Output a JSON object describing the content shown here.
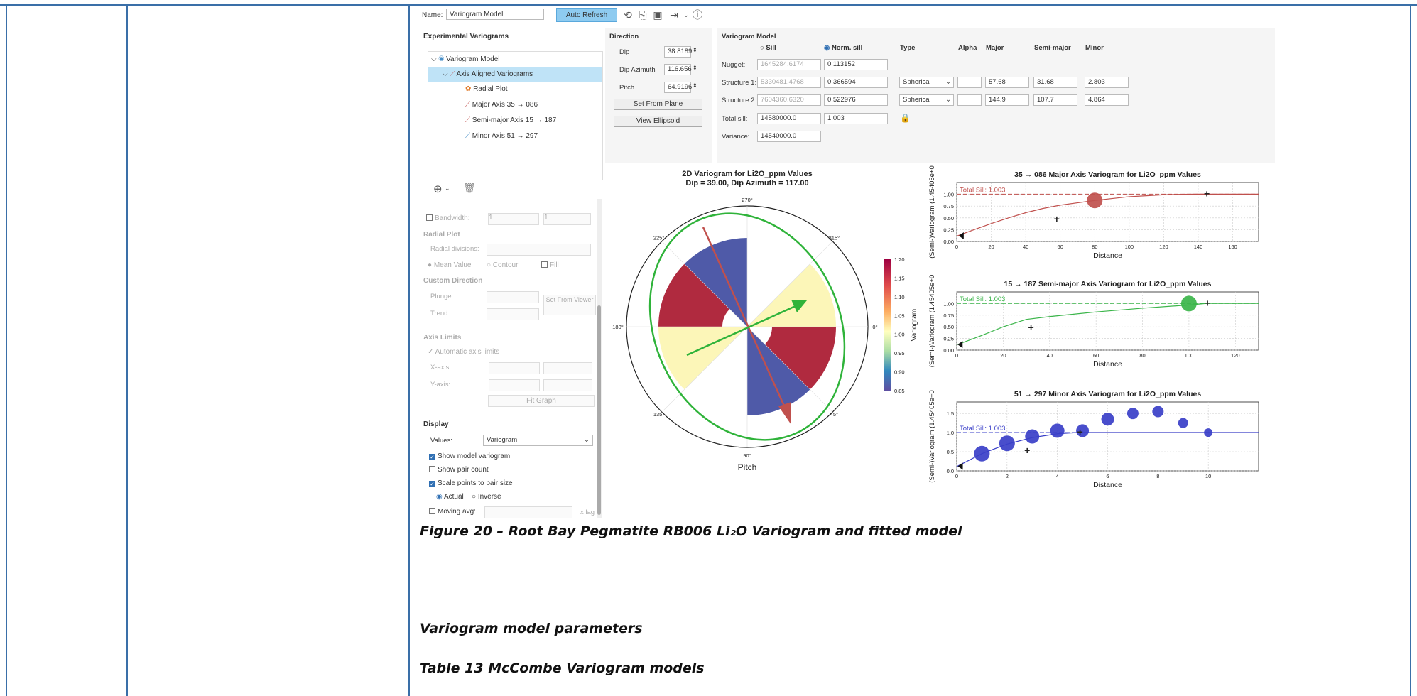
{
  "toolbar": {
    "name_label": "Name:",
    "name_value": "Variogram Model",
    "auto_refresh": "Auto Refresh"
  },
  "left": {
    "exp_title": "Experimental Variograms",
    "tree": [
      "Variogram Model",
      "Axis Aligned Variograms",
      "Radial Plot",
      "Major Axis 35 → 086",
      "Semi-major Axis 15 → 187",
      "Minor Axis 51 → 297"
    ],
    "bandwidth_label": "Bandwidth:",
    "bandwidth_a": "1",
    "bandwidth_b": "1",
    "radial_title": "Radial Plot",
    "radial_div": "Radial divisions:",
    "mean_value": "Mean Value",
    "contour": "Contour",
    "fill": "Fill",
    "custom_dir": "Custom Direction",
    "plunge": "Plunge:",
    "trend": "Trend:",
    "set_from_viewer": "Set From Viewer",
    "axis_limits": "Axis Limits",
    "auto_axis": "Automatic axis limits",
    "x_axis": "X-axis:",
    "y_axis": "Y-axis:",
    "fit_graph": "Fit Graph",
    "display": "Display",
    "values_label": "Values:",
    "values_sel": "Variogram",
    "show_model": "Show model variogram",
    "show_pair": "Show pair count",
    "scale_points": "Scale points to pair size",
    "actual": "Actual",
    "inverse": "Inverse",
    "moving_avg": "Moving avg:",
    "xlag": "x lag"
  },
  "direction": {
    "title": "Direction",
    "dip_label": "Dip",
    "dip": "38.8189",
    "dipaz_label": "Dip Azimuth",
    "dipaz": "116.656",
    "pitch_label": "Pitch",
    "pitch": "64.9196",
    "set_from_plane": "Set From Plane",
    "view_ellipsoid": "View Ellipsoid"
  },
  "vmodel": {
    "title": "Variogram Model",
    "sill": "Sill",
    "norm_sill": "Norm. sill",
    "type": "Type",
    "alpha": "Alpha",
    "major": "Major",
    "semi_major": "Semi-major",
    "minor": "Minor",
    "nugget_label": "Nugget:",
    "nugget_sill": "1645284.6174",
    "nugget_norm": "0.113152",
    "s1_label": "Structure 1:",
    "s1_sill": "5330481.4768",
    "s1_norm": "0.366594",
    "s1_type": "Spherical",
    "s1_major": "57.68",
    "s1_semi": "31.68",
    "s1_minor": "2.803",
    "s2_label": "Structure 2:",
    "s2_sill": "7604360.6320",
    "s2_norm": "0.522976",
    "s2_type": "Spherical",
    "s2_major": "144.9",
    "s2_semi": "107.7",
    "s2_minor": "4.864",
    "total_label": "Total sill:",
    "total_sill": "14580000.0",
    "total_norm": "1.003",
    "variance_label": "Variance:",
    "variance": "14540000.0"
  },
  "colors": {
    "red": "#b02a3f",
    "blue": "#4f5aa8",
    "yellow": "#fcf6b8",
    "green": "#2fb33a",
    "major": "#c0504d",
    "semi": "#3bb54a",
    "minorc": "#3a3fc8"
  },
  "chart_data": [
    {
      "type": "polar",
      "title": "2D Variogram for Li2O_ppm Values",
      "subtitle": "Dip = 39.00, Dip Azimuth = 117.00",
      "xlabel": "Pitch",
      "angle_labels": [
        "270°",
        "315°",
        "0°",
        "45°",
        "90°",
        "135°",
        "180°",
        "225°"
      ],
      "colorbar": {
        "label": "Variogram",
        "ticks": [
          "1.20",
          "1.15",
          "1.10",
          "1.05",
          "1.00",
          "0.95",
          "0.90",
          "0.85"
        ],
        "range": [
          0.85,
          1.2
        ]
      }
    },
    {
      "type": "line",
      "title": "35 → 086 Major Axis Variogram for Li2O_ppm Values",
      "xlabel": "Distance",
      "ylabel": "(Semi-)Variogram (1.45405e+0",
      "sill_label": "Total Sill: 1.003",
      "xlim": [
        0,
        175
      ],
      "ylim": [
        0,
        1.25
      ],
      "xticks": [
        "0",
        "20",
        "40",
        "60",
        "80",
        "100",
        "120",
        "140",
        "160"
      ],
      "yticks": [
        "0.00",
        "0.25",
        "0.50",
        "0.75",
        "1.00"
      ],
      "model": {
        "x": [
          0,
          10,
          20,
          30,
          40,
          50,
          60,
          70,
          80,
          90,
          100,
          110,
          120,
          130,
          140,
          175
        ],
        "y": [
          0.113,
          0.25,
          0.38,
          0.5,
          0.61,
          0.7,
          0.77,
          0.82,
          0.87,
          0.91,
          0.95,
          0.97,
          0.99,
          1.0,
          1.003,
          1.003
        ]
      },
      "points": [
        {
          "x": 80,
          "y": 0.87,
          "size": "large"
        }
      ],
      "plus": [
        {
          "x": 58,
          "y": 0.47
        },
        {
          "x": 145,
          "y": 1.0
        }
      ],
      "tri": [
        {
          "x": 2,
          "y": 0.12
        }
      ]
    },
    {
      "type": "line",
      "title": "15 → 187 Semi-major Axis Variogram for Li2O_ppm Values",
      "xlabel": "Distance",
      "ylabel": "(Semi-)Variogram (1.45405e+0",
      "sill_label": "Total Sill: 1.003",
      "xlim": [
        0,
        130
      ],
      "ylim": [
        0,
        1.25
      ],
      "xticks": [
        "0",
        "20",
        "40",
        "60",
        "80",
        "100",
        "120"
      ],
      "yticks": [
        "0.00",
        "0.25",
        "0.50",
        "0.75",
        "1.00"
      ],
      "model": {
        "x": [
          0,
          10,
          20,
          30,
          40,
          60,
          80,
          100,
          107.7,
          130
        ],
        "y": [
          0.113,
          0.3,
          0.5,
          0.66,
          0.72,
          0.82,
          0.9,
          0.97,
          1.003,
          1.003
        ]
      },
      "points": [
        {
          "x": 100,
          "y": 1.0,
          "size": "large"
        }
      ],
      "plus": [
        {
          "x": 32,
          "y": 0.47
        },
        {
          "x": 108,
          "y": 1.0
        }
      ],
      "tri": [
        {
          "x": 1,
          "y": 0.12
        }
      ]
    },
    {
      "type": "scatter",
      "title": "51 → 297 Minor Axis Variogram for Li2O_ppm Values",
      "xlabel": "Distance",
      "ylabel": "(Semi-)Variogram (1.45405e+0",
      "sill_label": "Total Sill: 1.003",
      "xlim": [
        0,
        12
      ],
      "ylim": [
        0,
        1.8
      ],
      "xticks": [
        "0",
        "2",
        "4",
        "6",
        "8",
        "10"
      ],
      "yticks": [
        "0.0",
        "0.5",
        "1.0",
        "1.5"
      ],
      "model": {
        "x": [
          0,
          1,
          2,
          3,
          4,
          4.864,
          12
        ],
        "y": [
          0.113,
          0.45,
          0.7,
          0.87,
          0.97,
          1.003,
          1.003
        ]
      },
      "points": [
        {
          "x": 1,
          "y": 0.45,
          "size": 11
        },
        {
          "x": 2,
          "y": 0.72,
          "size": 11
        },
        {
          "x": 3,
          "y": 0.9,
          "size": 10
        },
        {
          "x": 4,
          "y": 1.05,
          "size": 10
        },
        {
          "x": 5,
          "y": 1.05,
          "size": 9
        },
        {
          "x": 6,
          "y": 1.35,
          "size": 9
        },
        {
          "x": 7,
          "y": 1.5,
          "size": 8
        },
        {
          "x": 8,
          "y": 1.55,
          "size": 8
        },
        {
          "x": 9,
          "y": 1.25,
          "size": 7
        },
        {
          "x": 10,
          "y": 1.0,
          "size": 6
        }
      ],
      "plus": [
        {
          "x": 2.8,
          "y": 0.52
        },
        {
          "x": 4.9,
          "y": 1.0
        }
      ],
      "tri": [
        {
          "x": 0.1,
          "y": 0.12
        }
      ]
    }
  ],
  "doc": {
    "figure_caption": "Figure 20 – Root Bay Pegmatite RB006 Li₂O Variogram and fitted model",
    "heading": "Variogram model parameters",
    "table_caption": "Table 13 McCombe Variogram models"
  }
}
